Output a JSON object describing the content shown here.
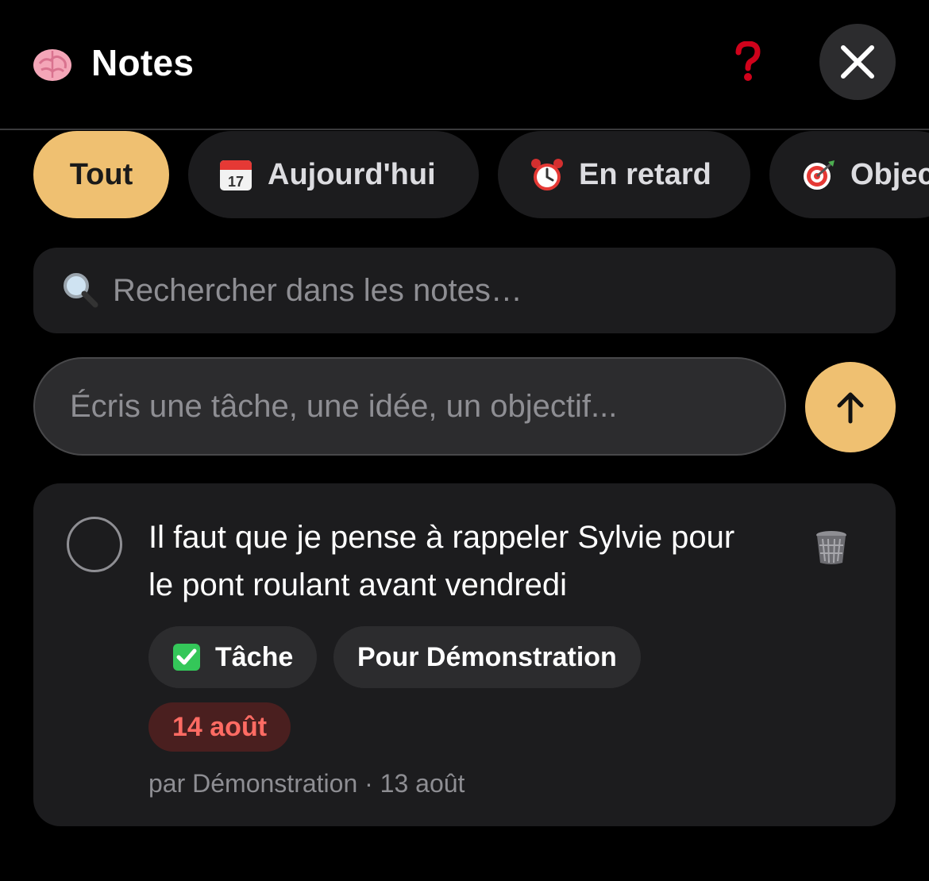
{
  "header": {
    "title": "Notes",
    "app_icon": "brain-icon",
    "help_icon": "question-mark-icon",
    "close_icon": "close-icon"
  },
  "filters": [
    {
      "label": "Tout",
      "icon": null,
      "active": true
    },
    {
      "label": "Aujourd'hui",
      "icon": "calendar-icon",
      "active": false
    },
    {
      "label": "En retard",
      "icon": "alarm-clock-icon",
      "active": false
    },
    {
      "label": "Objec",
      "icon": "target-icon",
      "active": false
    }
  ],
  "search": {
    "placeholder": "Rechercher dans les notes…",
    "icon": "magnifier-icon"
  },
  "composer": {
    "placeholder": "Écris une tâche, une idée, un objectif...",
    "submit_icon": "arrow-up-icon"
  },
  "notes": [
    {
      "text": "Il faut que je pense à rappeler Sylvie pour le pont roulant avant vendredi",
      "type_label": "Tâche",
      "assignee_label": "Pour Démonstration",
      "due_label": "14 août",
      "meta": "par Démonstration · 13 août"
    }
  ],
  "colors": {
    "accent": "#efc071",
    "background": "#000000",
    "surface": "#1c1c1e",
    "chip": "#1c1c1e",
    "overdue_text": "#ff6b63",
    "overdue_bg": "#4a1f1f",
    "muted_text": "#8e8e93"
  }
}
